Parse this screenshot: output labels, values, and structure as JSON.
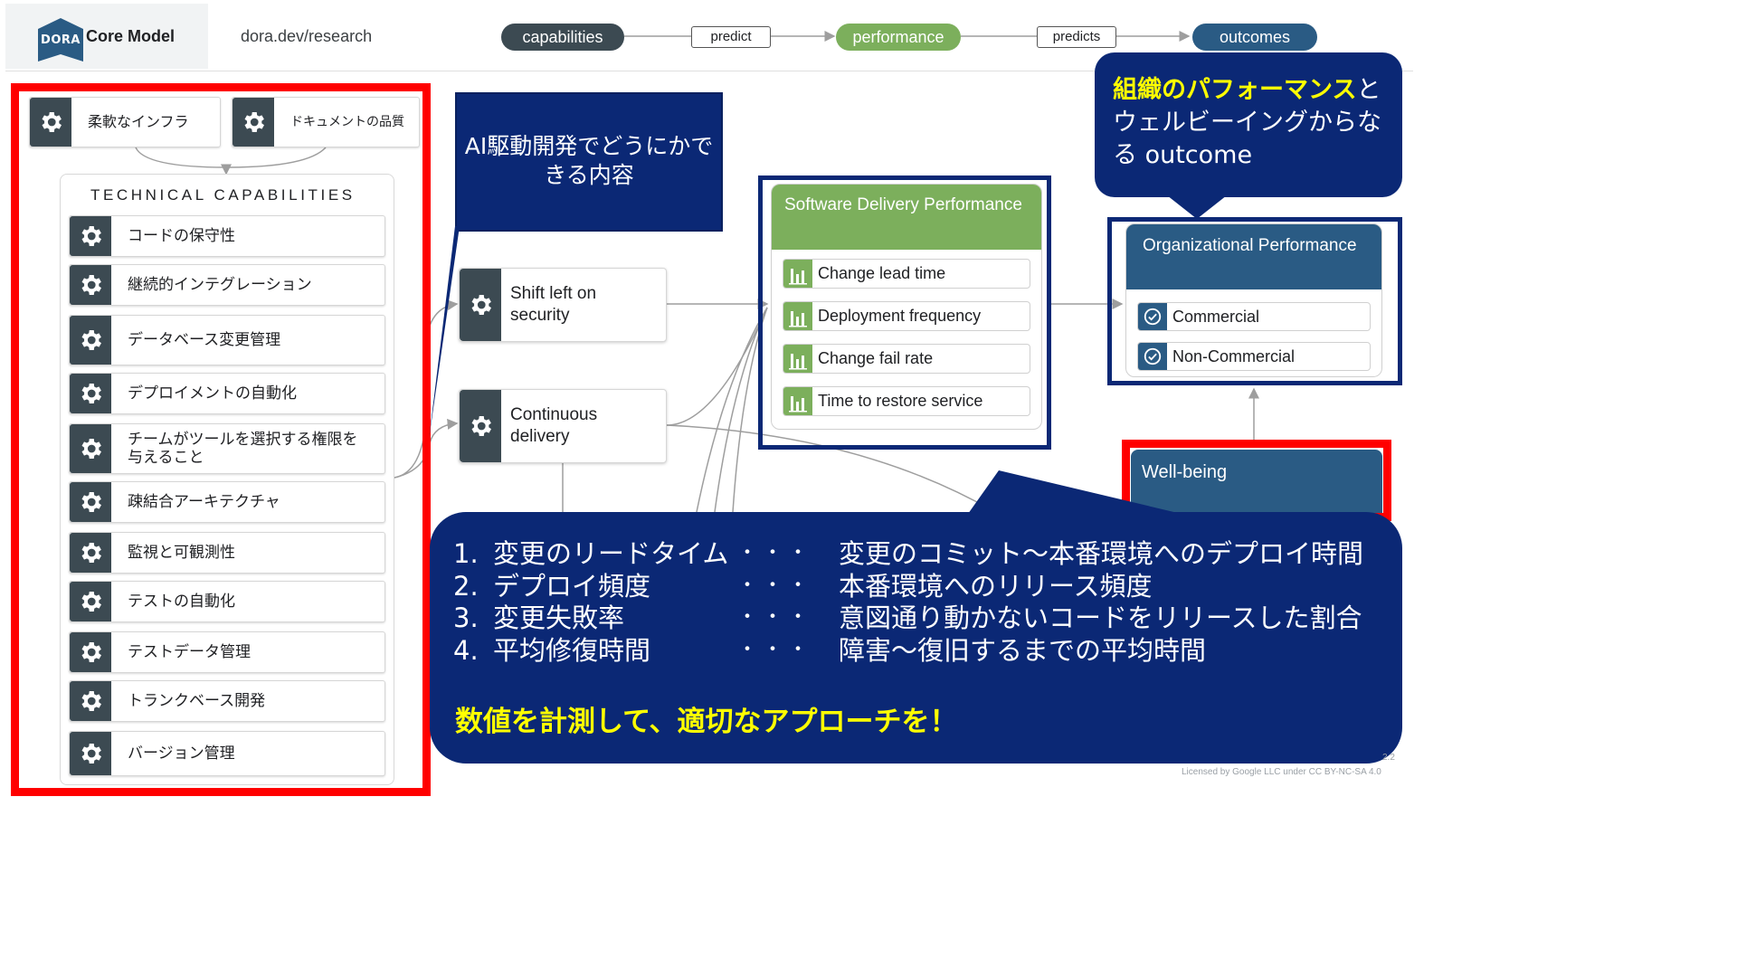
{
  "header": {
    "logo_text": "DORA",
    "brand": "Core Model",
    "url": "dora.dev/research",
    "flow": {
      "capabilities": "capabilities",
      "predict": "predict",
      "performance": "performance",
      "predicts": "predicts",
      "outcomes": "outcomes"
    }
  },
  "top_capabilities": [
    "柔軟なインフラ",
    "ドキュメントの品質"
  ],
  "technical": {
    "title": "TECHNICAL CAPABILITIES",
    "items": [
      "コードの保守性",
      "継続的インテグレーション",
      "データベース変更管理",
      "デプロイメントの自動化",
      "チームがツールを選択する権限を与えること",
      "疎結合アーキテクチャ",
      "監視と可観測性",
      "テストの自動化",
      "テストデータ管理",
      "トランクベース開発",
      "バージョン管理"
    ]
  },
  "ai_callout": "AI駆動開発でどうにかできる内容",
  "middle_capabilities": [
    "Shift left on security",
    "Continuous delivery"
  ],
  "software_delivery": {
    "title": "Software Delivery Performance",
    "metrics": [
      "Change lead time",
      "Deployment frequency",
      "Change fail rate",
      "Time to restore service"
    ]
  },
  "organizational": {
    "title": "Organizational Performance",
    "items": [
      "Commercial",
      "Non-Commercial"
    ]
  },
  "wellbeing": {
    "title": "Well-being"
  },
  "outcome_callout": {
    "highlight": "組織のパフォーマンス",
    "rest": "とウェルビーイングからなる outcome"
  },
  "metrics_callout": {
    "rows": [
      {
        "num": "1.",
        "name": "変更のリードタイム",
        "sep": "・・・",
        "desc": "変更のコミット～本番環境へのデプロイ時間"
      },
      {
        "num": "2.",
        "name": "デプロイ頻度",
        "sep": "・・・",
        "desc": "本番環境へのリリース頻度"
      },
      {
        "num": "3.",
        "name": "変更失敗率",
        "sep": "・・・",
        "desc": "意図通り動かないコードをリリースした割合"
      },
      {
        "num": "4.",
        "name": "平均修復時間",
        "sep": "・・・",
        "desc": "障害～復旧するまでの平均時間"
      }
    ],
    "cta": "数値を計測して、適切なアプローチを！"
  },
  "footer": {
    "license": "Licensed by Google LLC under CC BY-NC-SA 4.0",
    "version": "2.2"
  },
  "colors": {
    "navy_callout": "#0b2875",
    "highlight_yellow": "#ffff00",
    "frame_red": "#ff0000",
    "capability_dark": "#3c4a52",
    "performance_green": "#7caf5c",
    "outcome_blue": "#2a5b84"
  },
  "icons": {
    "capability": "gear-icon",
    "metric": "bar-chart-icon",
    "outcome": "check-circle-icon"
  }
}
